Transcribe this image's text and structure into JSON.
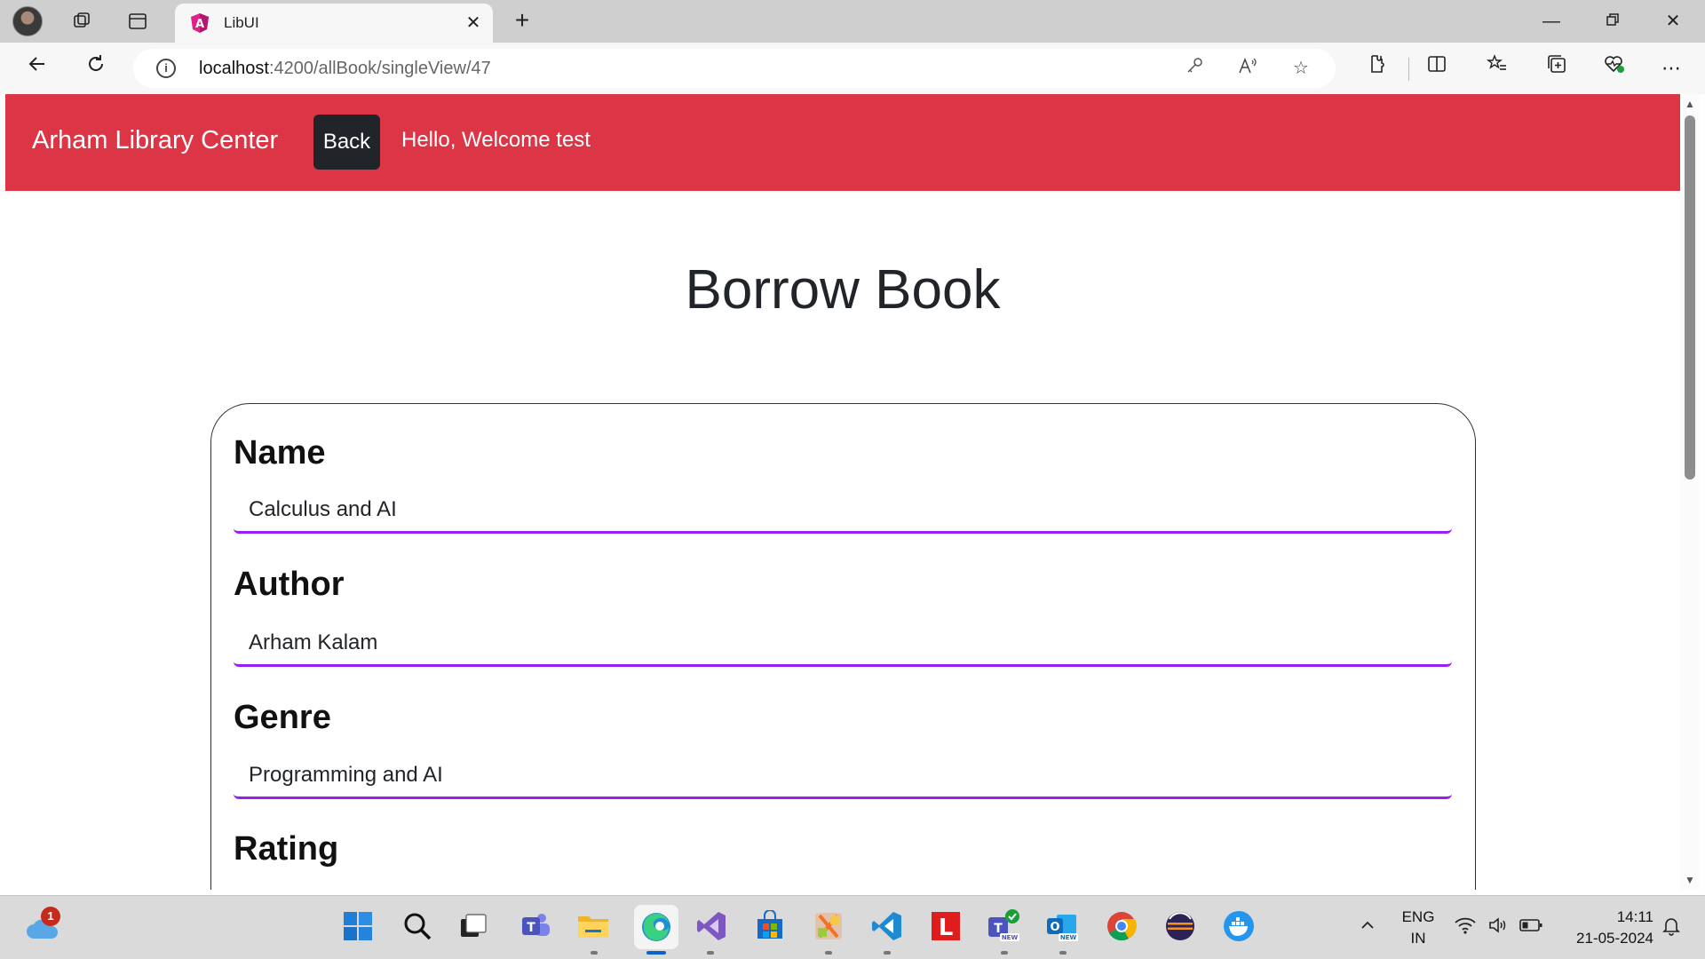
{
  "browser": {
    "tab_title": "LibUI",
    "url_host": "localhost",
    "url_path": ":4200/allBook/singleView/47"
  },
  "app": {
    "brand": "Arham Library Center",
    "back_label": "Back",
    "welcome": "Hello, Welcome test",
    "page_title": "Borrow Book",
    "accent_color": "#dc3545",
    "input_underline_color": "#9b1ff0"
  },
  "form": {
    "fields": [
      {
        "label": "Name",
        "value": "Calculus and AI"
      },
      {
        "label": "Author",
        "value": "Arham Kalam"
      },
      {
        "label": "Genre",
        "value": "Programming and AI"
      },
      {
        "label": "Rating",
        "value": ""
      }
    ]
  },
  "taskbar": {
    "weather_badge": "1",
    "lang_line1": "ENG",
    "lang_line2": "IN",
    "time": "14:11",
    "date": "21-05-2024",
    "icons": [
      "start-icon",
      "search-icon",
      "task-view-icon",
      "teams-icon",
      "file-explorer-icon",
      "edge-icon",
      "visual-studio-icon",
      "store-icon",
      "xampp-icon",
      "vscode-icon",
      "lens-icon",
      "teams-new-icon",
      "outlook-new-icon",
      "chrome-icon",
      "eclipse-icon",
      "docker-icon"
    ]
  }
}
